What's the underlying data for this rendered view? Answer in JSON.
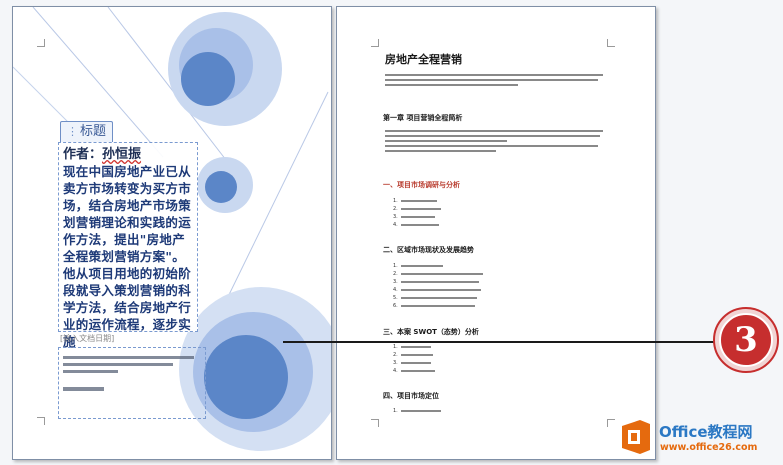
{
  "left_page": {
    "title_tag": "标题",
    "author_label": "作者：",
    "author_name": "孙恒振",
    "abstract_text": "现在中国房地产业已从卖方市场转变为买方市场，结合房地产市场策划营销理论和实践的运作方法，提出\"房地产全程策划营销方案\"。他从项目用地的初始阶段就导入策划营销的科学方法，结合房地产行业的运作流程，逐步实施",
    "placeholder_hint": "[输入文档日期]"
  },
  "right_page": {
    "doc_title": "房地产全程营销",
    "headings": [
      {
        "lead": "第一章",
        "text": "项目营销全程简析",
        "color": "#1a1a1a"
      },
      {
        "lead": "一、",
        "text": "项目市场调研与分析",
        "color": "#b83a2c"
      },
      {
        "lead": "二、",
        "text": "区域市场现状及发展趋势",
        "color": "#1a1a1a"
      },
      {
        "lead": "三、",
        "text": "本案 SWOT（态势）分析",
        "color": "#1a1a1a"
      },
      {
        "lead": "四、",
        "text": "项目市场定位",
        "color": "#1a1a1a"
      }
    ]
  },
  "callout": {
    "number": "3",
    "color": "#c62e2e"
  },
  "watermark": {
    "brand_top": "Office教程网",
    "brand_url": "www.office26.com",
    "brand_blue": "#2b78c4",
    "brand_orange": "#e56a0e"
  }
}
